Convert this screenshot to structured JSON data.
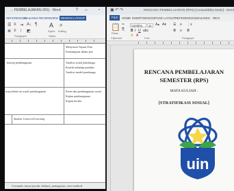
{
  "left_window": {
    "title": "... PEMBELAJARAN (RS) - Word",
    "ribbon_tabs": [
      "REFERENCES",
      "MAILINGS",
      "REVIEW",
      "VIEW",
      "DESIGN",
      "LAYOUT"
    ],
    "active_tab": "DESIGN LAYOUT",
    "ribbon_groups": [
      "Paragraph",
      "Styles",
      "Editing"
    ],
    "ribbon_buttons": {
      "styles": "Styles",
      "editing": "Editing"
    },
    "cells": {
      "r1c2_a": "Menyusun Tujuan Pem",
      "r1c2_b": "Kemampuan dalam pen",
      "r2c1": "konsep pembangunan",
      "r2c2_a": "Analisis sosial pembangu",
      "r2c2_b": "Konfik terhadap pemban",
      "r2c2_c": "Analisis model pembangu",
      "r3c1": "nsep kebiri-an sosial pembangunan",
      "r3c2_a": "Peran dan pembangunan sosial",
      "r3c2_b": "Kajian pembangunan",
      "r3c2_c": "Kajian kesiku",
      "r4c1": "Student Centered Learning"
    },
    "bottom_note": "Ceramah, tanya jawab, diskusi, penugasan, case method"
  },
  "right_window": {
    "qat_icons": [
      "save-icon",
      "undo-icon",
      "redo-icon"
    ],
    "title": "RENCANA PEMBELAJARAN (RPS) [Compatibility Mode] - Word",
    "ribbon_tabs": [
      "FILE",
      "HOME",
      "INSERT",
      "DESIGN",
      "PAGE LAYOUT",
      "REFERENCES",
      "MAILINGS",
      "REVI"
    ],
    "font_name": "Cambria",
    "font_size": "11",
    "ribbon_groups": [
      "Clipboard",
      "Font",
      "Paragraph"
    ],
    "paste_label": "Paste"
  },
  "document": {
    "title_line1": "RENCANA PEMBELAJARAN",
    "title_line2": "SEMESTER (RPS)",
    "subtitle": "MATA KULIAH :",
    "course": "[STRATIFIKASI SOSIAL]",
    "logo_text": "uin"
  },
  "colors": {
    "word_blue": "#2b579a",
    "logo_ring": "#1f4fa8",
    "logo_leaf_green": "#3aa648",
    "logo_yellow": "#f6d64a"
  }
}
